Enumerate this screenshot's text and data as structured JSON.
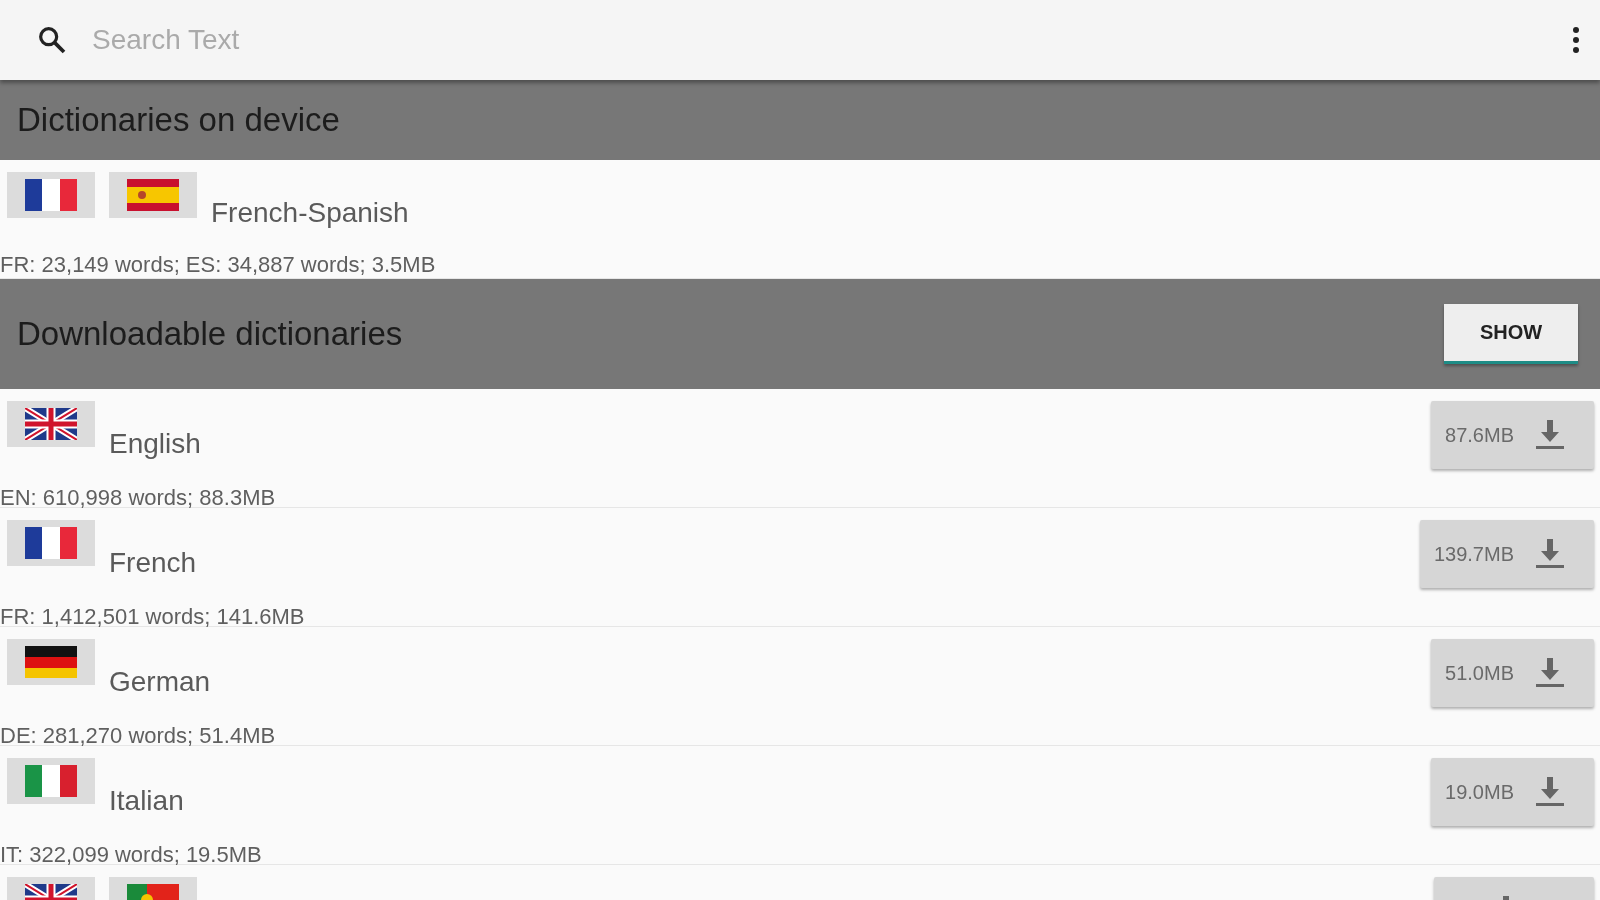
{
  "search": {
    "placeholder": "Search Text"
  },
  "sections": [
    {
      "title": "Dictionaries on device",
      "rows": [
        {
          "kind": "installed",
          "flags": [
            {
              "kind": "fr"
            },
            {
              "kind": "es"
            }
          ],
          "name": "French-Spanish",
          "info": "FR: 23,149 words; ES: 34,887 words; 3.5MB"
        }
      ]
    },
    {
      "title": "Downloadable dictionaries",
      "button": "SHOW",
      "rows": [
        {
          "kind": "downloadable",
          "flags": [
            {
              "kind": "gb"
            }
          ],
          "name": "English",
          "info": "EN: 610,998 words; 88.3MB",
          "size": "87.6MB"
        },
        {
          "kind": "downloadable",
          "flags": [
            {
              "kind": "fr"
            }
          ],
          "name": "French",
          "info": "FR: 1,412,501 words; 141.6MB",
          "size": "139.7MB"
        },
        {
          "kind": "downloadable",
          "flags": [
            {
              "kind": "de"
            }
          ],
          "name": "German",
          "info": "DE: 281,270 words; 51.4MB",
          "size": "51.0MB"
        },
        {
          "kind": "downloadable",
          "flags": [
            {
              "kind": "it"
            }
          ],
          "name": "Italian",
          "info": "IT: 322,099 words; 19.5MB",
          "size": "19.0MB"
        },
        {
          "kind": "downloadable",
          "flags": [
            {
              "kind": "gb"
            },
            {
              "kind": "pt"
            }
          ]
        }
      ]
    }
  ]
}
